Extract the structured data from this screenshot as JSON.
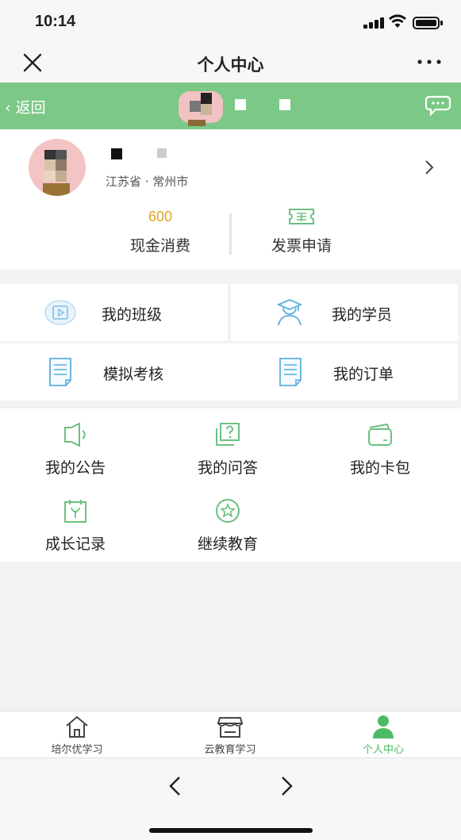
{
  "status_bar": {
    "time": "10:14"
  },
  "title_bar": {
    "title": "个人中心",
    "close_icon": "close-icon",
    "more_icon": "more-icon"
  },
  "header": {
    "back_label": "返回",
    "chat_icon": "chat-icon"
  },
  "profile": {
    "location": "江苏省 · 常州市",
    "stats": [
      {
        "value": "600",
        "label": "现金消费"
      },
      {
        "icon": "ticket-icon",
        "label": "发票申请"
      }
    ]
  },
  "quick_menu": [
    {
      "label": "我的班级",
      "icon": "video-book-icon"
    },
    {
      "label": "我的学员",
      "icon": "graduate-icon"
    },
    {
      "label": "模拟考核",
      "icon": "document-icon"
    },
    {
      "label": "我的订单",
      "icon": "document-icon"
    }
  ],
  "service_grid": [
    {
      "label": "我的公告",
      "icon": "speaker-icon"
    },
    {
      "label": "我的问答",
      "icon": "question-icon"
    },
    {
      "label": "我的卡包",
      "icon": "wallet-icon"
    },
    {
      "label": "成长记录",
      "icon": "calendar-sprout-icon"
    },
    {
      "label": "继续教育",
      "icon": "star-badge-icon"
    }
  ],
  "tabs": [
    {
      "label": "培尔优学习",
      "icon": "home-icon",
      "active": false
    },
    {
      "label": "云教育学习",
      "icon": "store-icon",
      "active": false
    },
    {
      "label": "个人中心",
      "icon": "person-icon",
      "active": true
    }
  ],
  "colors": {
    "accent_green": "#7cc887",
    "tab_active": "#4dbb64",
    "stat_value": "#e0a21f",
    "icon_green": "#6cc081",
    "icon_blue": "#5aaee0"
  }
}
